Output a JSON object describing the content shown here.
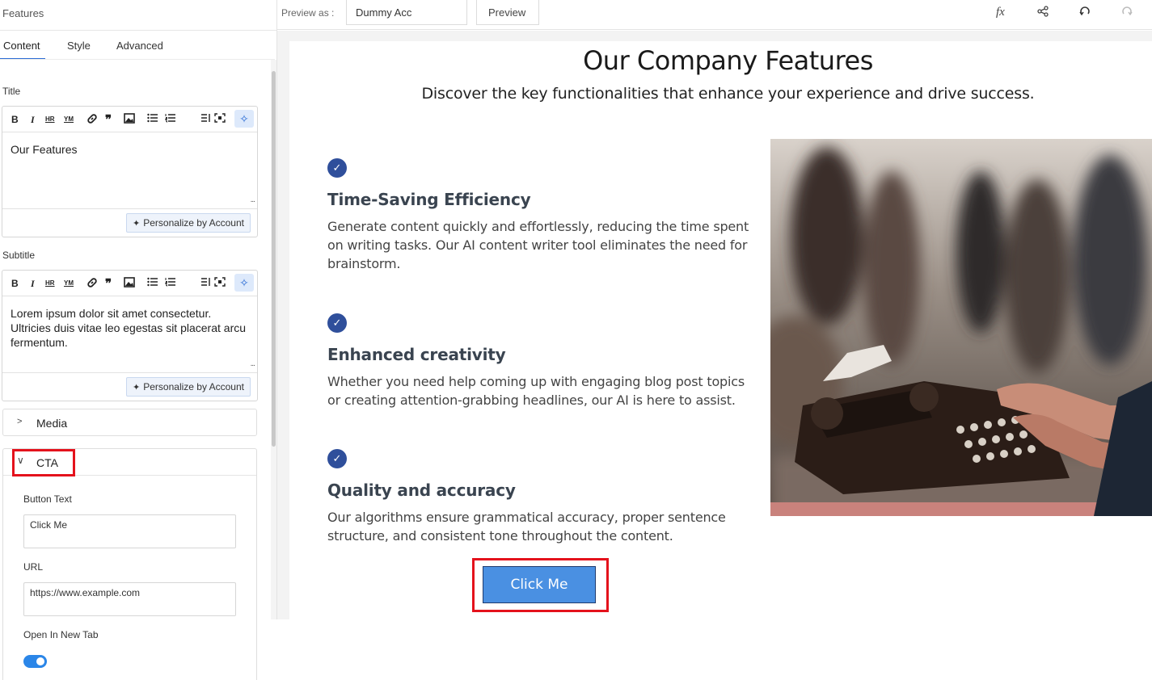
{
  "panel": {
    "title": "Features",
    "tabs": [
      "Content",
      "Style",
      "Advanced"
    ],
    "title_label": "Title",
    "title_value": "Our Features",
    "subtitle_label": "Subtitle",
    "subtitle_value": "Lorem ipsum dolor sit amet consectetur. Ultricies duis vitae leo egestas sit placerat arcu fermentum.",
    "personalize_label": "Personalize by Account",
    "toolbar": {
      "bold": "B",
      "italic": "I",
      "hr": "HR",
      "ym": "YM"
    },
    "media_label": "Media",
    "cta_label": "CTA",
    "button_text_label": "Button Text",
    "button_text_value": "Click Me",
    "url_label": "URL",
    "url_value": "https://www.example.com",
    "new_tab_label": "Open In New Tab",
    "new_tab_on": true
  },
  "topbar": {
    "preview_as": "Preview as :",
    "account": "Dummy Acc",
    "preview_button": "Preview",
    "fx_icon": "fx"
  },
  "canvas": {
    "heading": "Our Company Features",
    "subheading": "Discover the key functionalities that enhance your experience and drive success.",
    "features": [
      {
        "title": "Time-Saving Efficiency",
        "body": "Generate content quickly and effortlessly, reducing the time spent on writing tasks. Our AI content writer tool eliminates the need for brainstorm."
      },
      {
        "title": "Enhanced creativity",
        "body": "Whether you need help coming up with engaging blog post topics or creating attention-grabbing headlines, our AI is here to assist."
      },
      {
        "title": "Quality and accuracy",
        "body": "Our algorithms ensure grammatical accuracy, proper sentence structure, and consistent tone throughout the content."
      }
    ],
    "cta_button": "Click Me"
  },
  "colors": {
    "accent": "#2b6cd4",
    "check": "#2f4f9b",
    "cta": "#4a90e2",
    "highlight": "#e4121c"
  }
}
